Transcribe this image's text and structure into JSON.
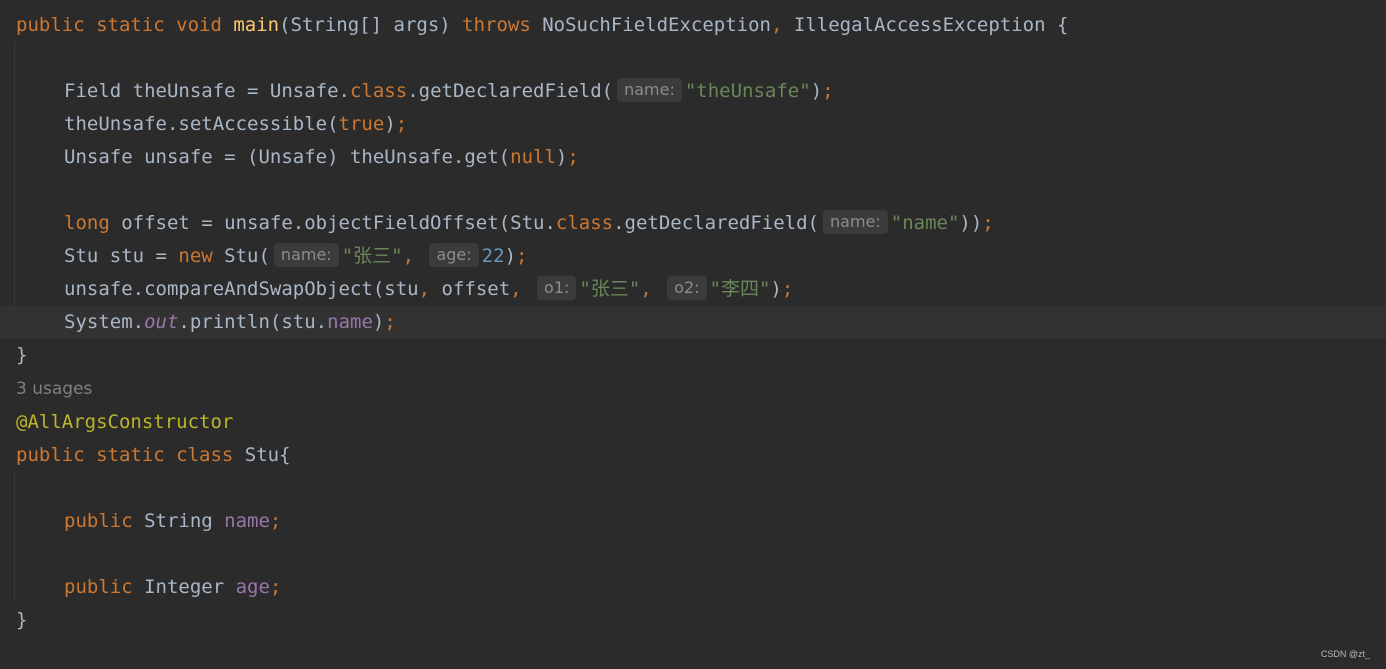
{
  "theme": {
    "background": "#2b2b2b",
    "caret_row": "#323232",
    "default_text": "#a9b7c6",
    "keyword": "#cc7832",
    "method_decl": "#ffc66d",
    "string": "#6a8759",
    "number": "#6897bb",
    "field": "#9876aa",
    "annotation": "#bbb529",
    "hint_bg": "#3b3b3b",
    "hint_text": "#8c8c8c"
  },
  "code": {
    "l1": {
      "t1": "public static void ",
      "t2": "main",
      "t3": "(String[] args) ",
      "t4": "throws ",
      "t5": "NoSuchFieldException",
      "t6": ", ",
      "t7": "IllegalAccessException {"
    },
    "l3": {
      "t1": "Field theUnsafe = Unsafe.",
      "t2": "class",
      "t3": ".getDeclaredField(",
      "hint": "name:",
      "t4": "\"theUnsafe\"",
      "t5": ")",
      "t6": ";"
    },
    "l4": {
      "t1": "theUnsafe.setAccessible(",
      "t2": "true",
      "t3": ")",
      "t4": ";"
    },
    "l5": {
      "t1": "Unsafe unsafe = (Unsafe) theUnsafe.get(",
      "t2": "null",
      "t3": ")",
      "t4": ";"
    },
    "l7": {
      "t1": "long ",
      "t2": "offset = unsafe.objectFieldOffset(Stu.",
      "t3": "class",
      "t4": ".getDeclaredField(",
      "hint": "name:",
      "t5": "\"name\"",
      "t6": "))",
      "t7": ";"
    },
    "l8": {
      "t1": "Stu stu = ",
      "t2": "new ",
      "t3": "Stu(",
      "hint1": "name:",
      "t4": "\"张三\"",
      "t5": ", ",
      "hint2": "age:",
      "t6": "22",
      "t7": ")",
      "t8": ";"
    },
    "l9": {
      "t1": "unsafe.compareAndSwapObject(stu",
      "t2": ", ",
      "t3": "offset",
      "t4": ", ",
      "hint1": "o1:",
      "t5": "\"张三\"",
      "t6": ", ",
      "hint2": "o2:",
      "t7": "\"李四\"",
      "t8": ")",
      "t9": ";"
    },
    "l10": {
      "t1": "System.",
      "t2": "out",
      "t3": ".println(stu.",
      "t4": "name",
      "t5": ")",
      "t6": ";"
    },
    "l11": {
      "t1": "}"
    },
    "usages": "3 usages",
    "l12": {
      "t1": "@AllArgsConstructor"
    },
    "l13": {
      "t1": "public static class ",
      "t2": "Stu{"
    },
    "l15": {
      "t1": "public ",
      "t2": "String ",
      "t3": "name",
      "t4": ";"
    },
    "l17": {
      "t1": "public ",
      "t2": "Integer ",
      "t3": "age",
      "t4": ";"
    },
    "l18": {
      "t1": "}"
    }
  },
  "watermark": "CSDN @zt_"
}
